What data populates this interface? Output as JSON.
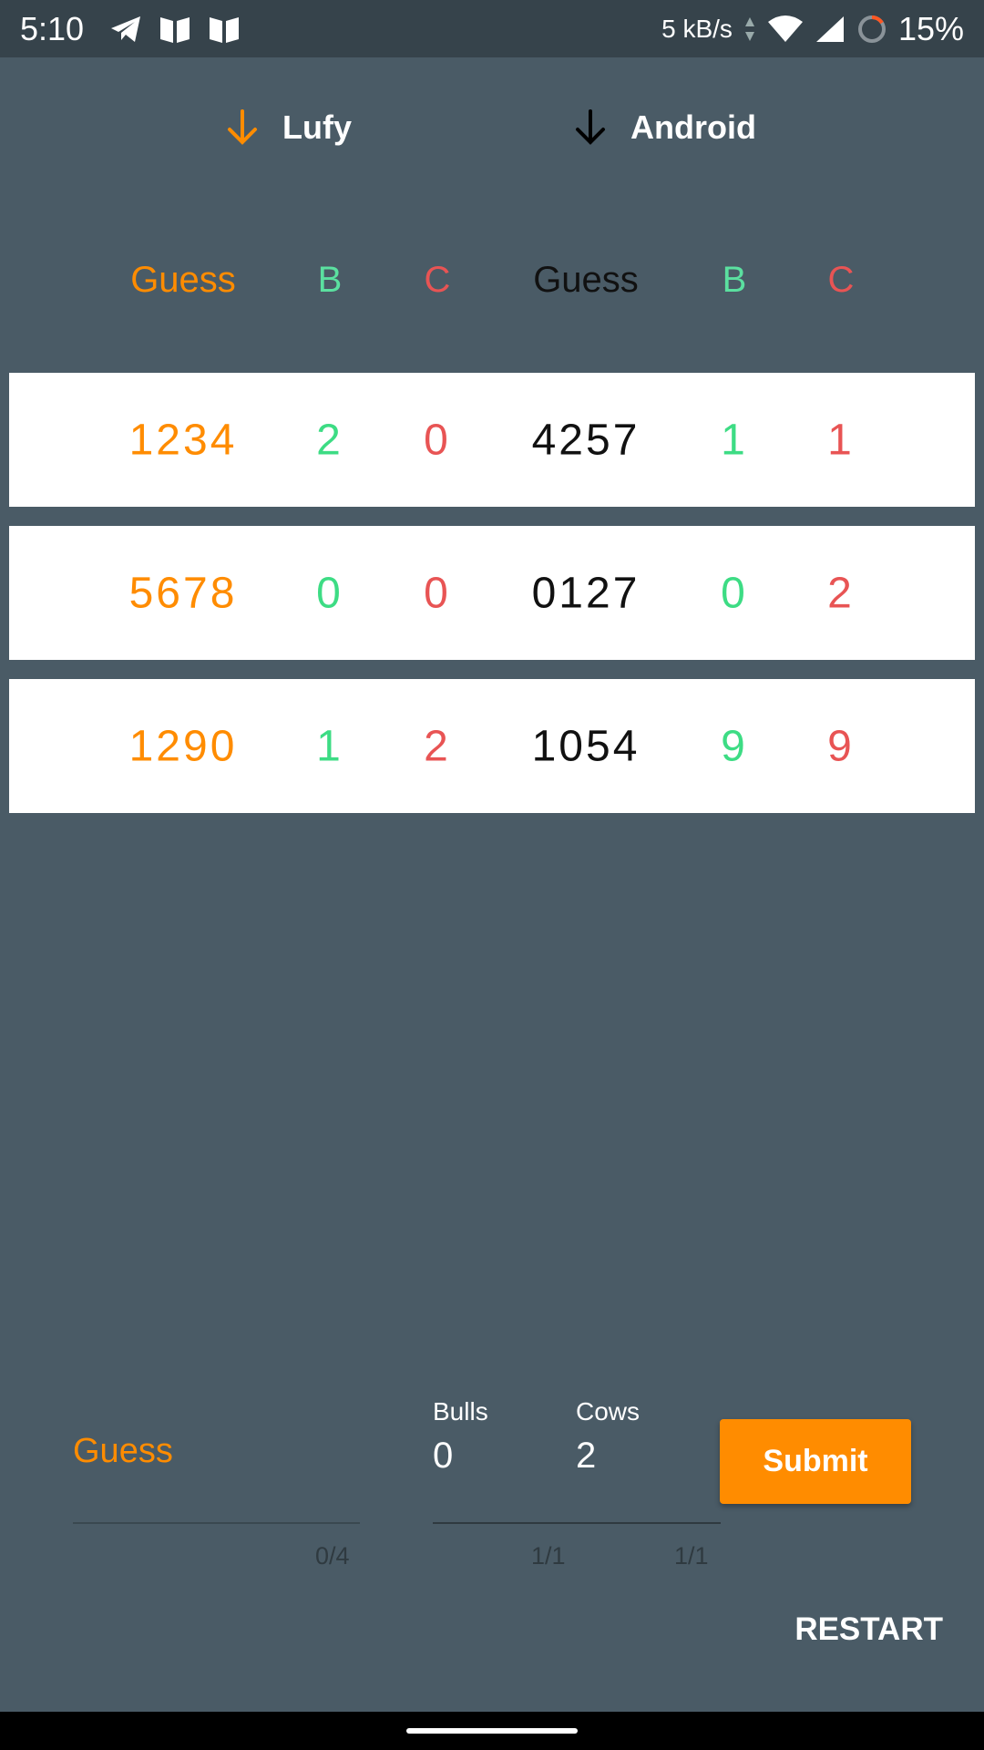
{
  "status_bar": {
    "time": "5:10",
    "speed": "5 kB/s",
    "battery": "15%"
  },
  "players": {
    "player1": "Lufy",
    "player2": "Android"
  },
  "headers": {
    "guess1": "Guess",
    "b1": "B",
    "c1": "C",
    "guess2": "Guess",
    "b2": "B",
    "c2": "C"
  },
  "rows": [
    {
      "g1": "1234",
      "b1": "2",
      "c1": "0",
      "g2": "4257",
      "b2": "1",
      "c2": "1"
    },
    {
      "g1": "5678",
      "b1": "0",
      "c1": "0",
      "g2": "0127",
      "b2": "0",
      "c2": "2"
    },
    {
      "g1": "1290",
      "b1": "1",
      "c1": "2",
      "g2": "1054",
      "b2": "9",
      "c2": "9"
    }
  ],
  "form": {
    "guess_placeholder": "Guess",
    "guess_counter": "0/4",
    "bulls_label": "Bulls",
    "bulls_value": "0",
    "bulls_counter": "1/1",
    "cows_label": "Cows",
    "cows_value": "2",
    "cows_counter": "1/1",
    "submit_label": "Submit"
  },
  "restart_label": "RESTART",
  "colors": {
    "background": "#4a5b66",
    "accent": "#ff8c00",
    "bulls": "#3ddc84",
    "cows": "#e85454"
  }
}
